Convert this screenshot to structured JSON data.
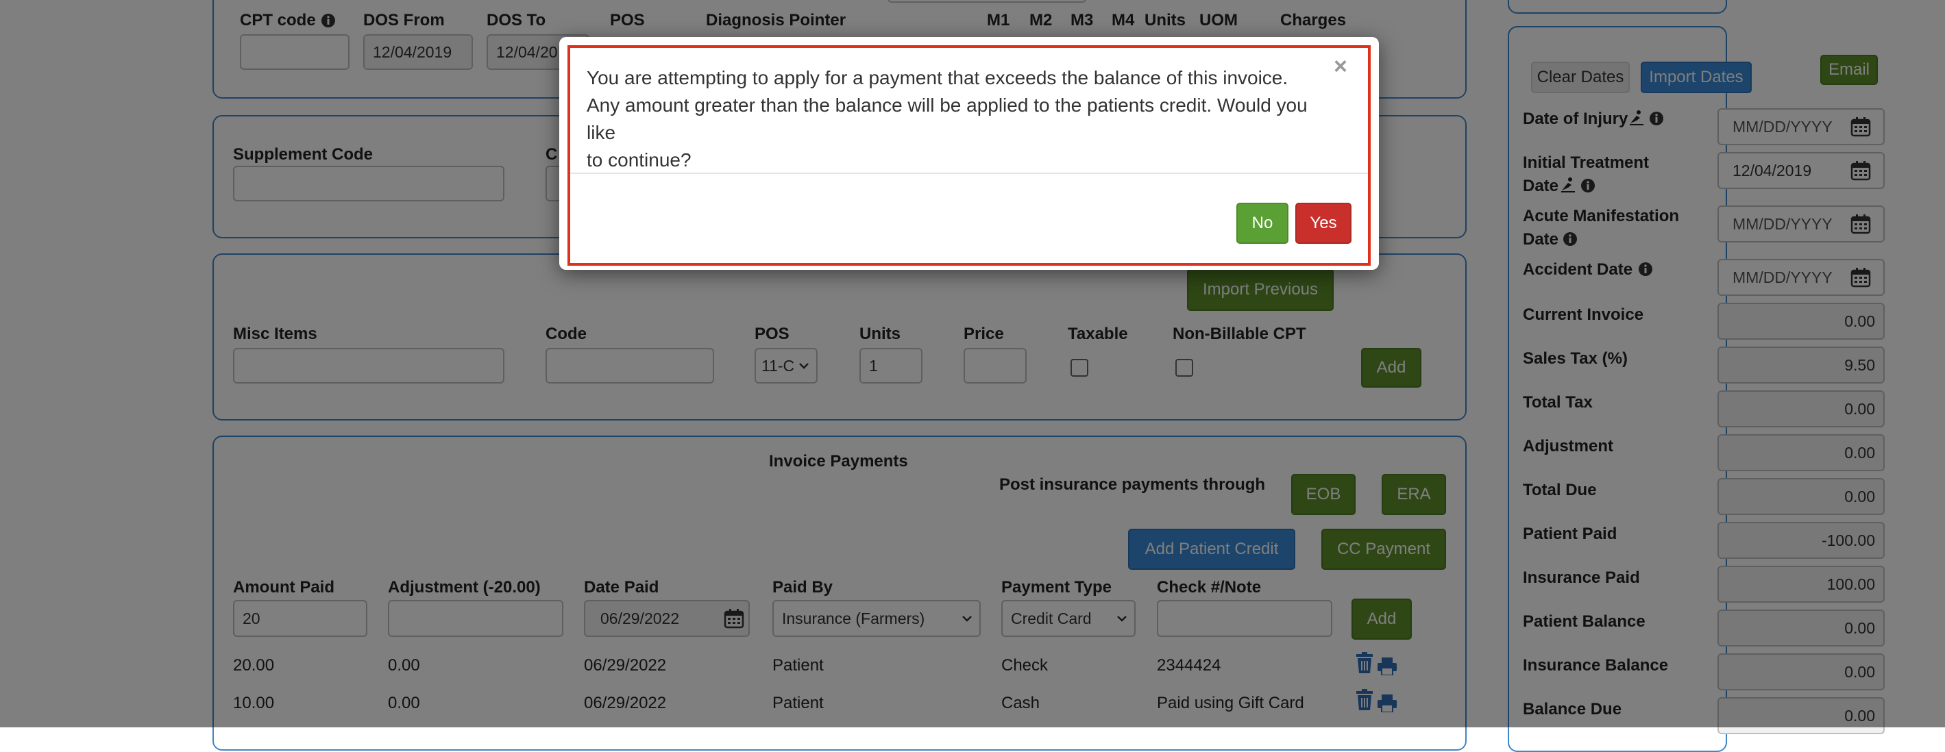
{
  "service_row": {
    "cpt_code": "CPT code",
    "dos_from": "DOS From",
    "dos_to": "DOS To",
    "pos": "POS",
    "diagnosis_pointer": "Diagnosis Pointer",
    "m1": "M1",
    "m2": "M2",
    "m3": "M3",
    "m4": "M4",
    "units": "Units",
    "uom": "UOM",
    "charges": "Charges",
    "dos_from_value": "12/04/2019",
    "dos_to_value": "12/04/20"
  },
  "supplement": {
    "label": "Supplement Code",
    "code_partial": "C"
  },
  "misc": {
    "import_previous": "Import Previous",
    "misc_items": "Misc Items",
    "code": "Code",
    "pos": "POS",
    "units": "Units",
    "price": "Price",
    "taxable": "Taxable",
    "non_billable": "Non-Billable CPT",
    "pos_value": "11-C",
    "units_value": "1",
    "add": "Add"
  },
  "payments": {
    "title": "Invoice Payments",
    "post_through": "Post insurance payments through",
    "eob": "EOB",
    "era": "ERA",
    "add_patient_credit": "Add Patient Credit",
    "cc_payment": "CC Payment",
    "headers": {
      "amount_paid": "Amount Paid",
      "adjustment": "Adjustment (-20.00)",
      "date_paid": "Date Paid",
      "paid_by": "Paid By",
      "payment_type": "Payment Type",
      "check_note": "Check #/Note"
    },
    "new": {
      "amount": "20",
      "date": "06/29/2022",
      "paid_by": "Insurance (Farmers)",
      "payment_type": "Credit Card",
      "add": "Add"
    },
    "rows": [
      {
        "amount": "20.00",
        "adjustment": "0.00",
        "date": "06/29/2022",
        "paid_by": "Patient",
        "type": "Check",
        "note": "2344424"
      },
      {
        "amount": "10.00",
        "adjustment": "0.00",
        "date": "06/29/2022",
        "paid_by": "Patient",
        "type": "Cash",
        "note": "Paid using Gift Card"
      }
    ]
  },
  "sidebar": {
    "clear_dates": "Clear Dates",
    "import_dates": "Import Dates",
    "email": "Email",
    "date_of_injury": "Date of Injury",
    "initial_treatment_1": "Initial Treatment",
    "initial_treatment_2": "Date",
    "acute_1": "Acute Manifestation",
    "acute_2": "Date",
    "accident_date": "Accident Date",
    "date_placeholder": "MM/DD/YYYY",
    "initial_treatment_value": "12/04/2019",
    "totals": [
      {
        "label": "Current Invoice",
        "value": "0.00"
      },
      {
        "label": "Sales Tax (%)",
        "value": "9.50"
      },
      {
        "label": "Total Tax",
        "value": "0.00"
      },
      {
        "label": "Adjustment",
        "value": "0.00"
      },
      {
        "label": "Total Due",
        "value": "0.00"
      },
      {
        "label": "Patient Paid",
        "value": "-100.00"
      },
      {
        "label": "Insurance Paid",
        "value": "100.00"
      },
      {
        "label": "Patient Balance",
        "value": "0.00"
      },
      {
        "label": "Insurance Balance",
        "value": "0.00"
      },
      {
        "label": "Balance Due",
        "value": "0.00"
      }
    ]
  },
  "modal": {
    "message_1": "You are attempting to apply for a payment that exceeds the balance of this invoice.",
    "message_2": "Any amount greater than the balance will be applied to the patients credit. Would you like",
    "message_3": "to continue?",
    "close": "×",
    "no": "No",
    "yes": "Yes"
  },
  "colors": {
    "accent_blue": "#3b88d4",
    "green": "#5c8e2a",
    "red": "#c9302c",
    "highlight": "#e0311c"
  }
}
